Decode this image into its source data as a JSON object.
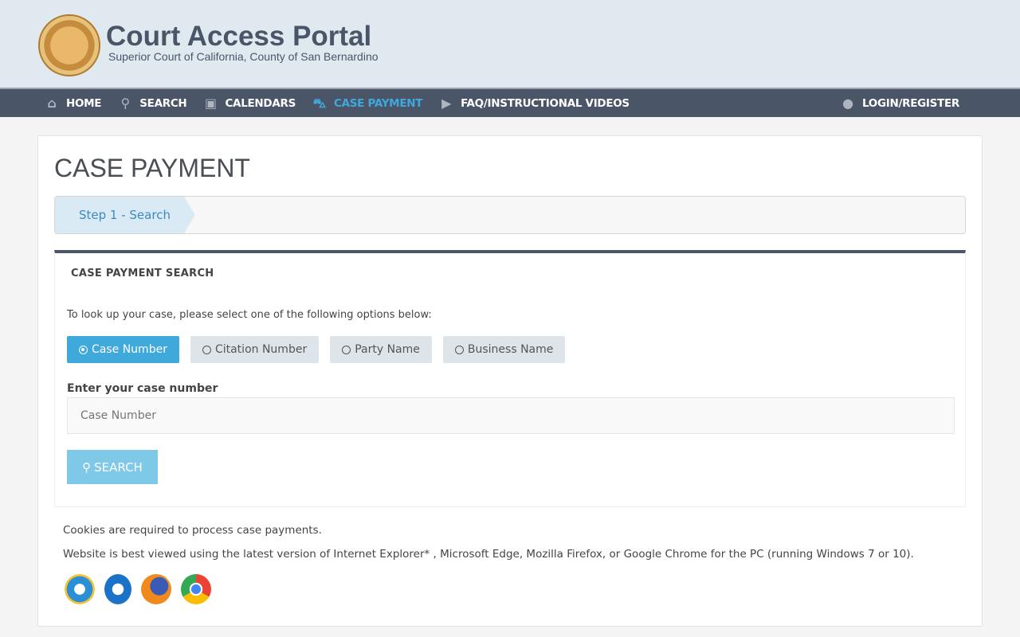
{
  "header": {
    "title": "Court Access Portal",
    "subtitle": "Superior Court of California, County of San Bernardino",
    "seal_text": "Superior Court of California County of San Bernardino"
  },
  "nav": {
    "items": [
      {
        "label": "HOME",
        "icon": "home-icon"
      },
      {
        "label": "SEARCH",
        "icon": "search-icon"
      },
      {
        "label": "CALENDARS",
        "icon": "calendar-icon"
      },
      {
        "label": "CASE PAYMENT",
        "icon": "car-icon",
        "active": true
      },
      {
        "label": "FAQ/INSTRUCTIONAL VIDEOS",
        "icon": "video-icon"
      }
    ],
    "login": "LOGIN/REGISTER",
    "active_color": "#3fa9dc"
  },
  "page": {
    "title": "CASE PAYMENT",
    "step": "Step 1 - Search"
  },
  "panel": {
    "heading": "CASE PAYMENT SEARCH",
    "intro": "To look up your case, please select one of the following options below:",
    "options": [
      {
        "label": "Case Number",
        "selected": true
      },
      {
        "label": "Citation Number"
      },
      {
        "label": "Party Name"
      },
      {
        "label": "Business Name"
      }
    ],
    "field_label": "Enter your case number",
    "field_placeholder": "Case Number",
    "field_value": "",
    "search_label": "SEARCH"
  },
  "notes": [
    "Cookies are required to process case payments.",
    "Website is best viewed using the latest version of Internet Explorer* , Microsoft Edge, Mozilla Firefox, or Google Chrome for the PC (running Windows 7 or 10)."
  ],
  "browsers": [
    "internet-explorer",
    "edge",
    "firefox",
    "chrome"
  ]
}
